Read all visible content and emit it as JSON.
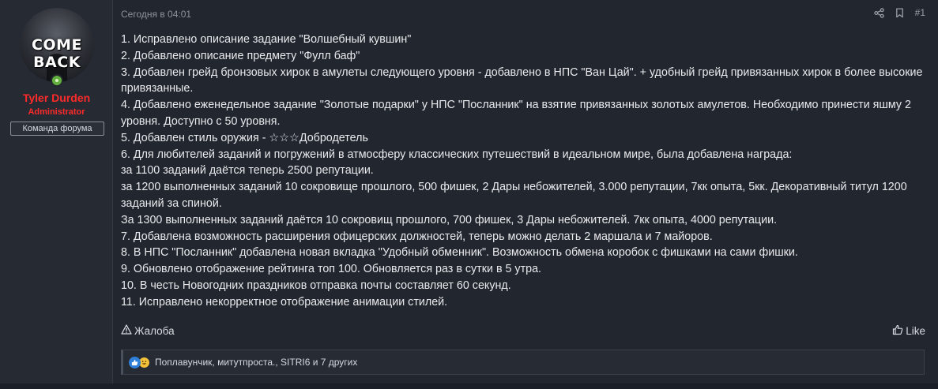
{
  "user": {
    "avatar_text": "COME BACK",
    "name": "Tyler Durden",
    "title": "Administrator",
    "banner": "Команда форума",
    "name_color": "#ff2a2a"
  },
  "post": {
    "date": "Сегодня в 04:01",
    "number": "#1",
    "lines": [
      "1. Исправлено описание задание \"Волшебный кувшин\"",
      "2. Добавлено описание предмету \"Фулл баф\"",
      "3. Добавлен грейд бронзовых хирок в амулеты следующего уровня - добавлено в НПС \"Ван Цай\". + удобный грейд привязанных хирок в более высокие привязанные.",
      "4. Добавлено еженедельное задание \"Золотые подарки\" у НПС \"Посланник\" на взятие привязанных золотых амулетов. Необходимо принести яшму 2 уровня. Доступно с 50 уровня.",
      "5. Добавлен стиль оружия - ☆☆☆Добродетель",
      "6. Для любителей заданий и погружений в атмосферу классических путешествий в идеальном мире, была добавлена награда:",
      "за 1100 заданий даётся теперь 2500 репутации.",
      "за 1200 выполненных заданий 10 сокровище прошлого, 500 фишек, 2 Дары небожителей, 3.000 репутации, 7кк опыта, 5кк. Декоративный титул 1200 заданий за спиной.",
      "За 1300 выполненных заданий даётся 10 сокровищ прошлого, 700 фишек, 3 Дары небожителей. 7кк опыта, 4000 репутации.",
      "7. Добавлена возможность расширения офицерских должностей, теперь можно делать 2 маршала и 7 майоров.",
      "8. В НПС \"Посланник\" добавлена новая вкладка \"Удобный обменник\". Возможность обмена коробок с фишками на сами фишки.",
      "9. Обновлено отображение рейтинга топ 100. Обновляется раз в сутки в 5 утра.",
      "10. В честь Новогодних праздников отправка почты составляет 60 секунд.",
      "11. Исправлено некорректное отображение анимации стилей."
    ],
    "report_label": "Жалоба",
    "like_label": "Like",
    "reactions_text": "Поплавунчик, митутпроста., SITRI6 и 7 других"
  },
  "icons": {
    "share": "share-icon",
    "bookmark": "bookmark-icon",
    "report": "warning-icon",
    "like": "thumbs-up-icon",
    "reaction_like": "like-reaction-icon",
    "reaction_haha": "haha-reaction-icon"
  }
}
